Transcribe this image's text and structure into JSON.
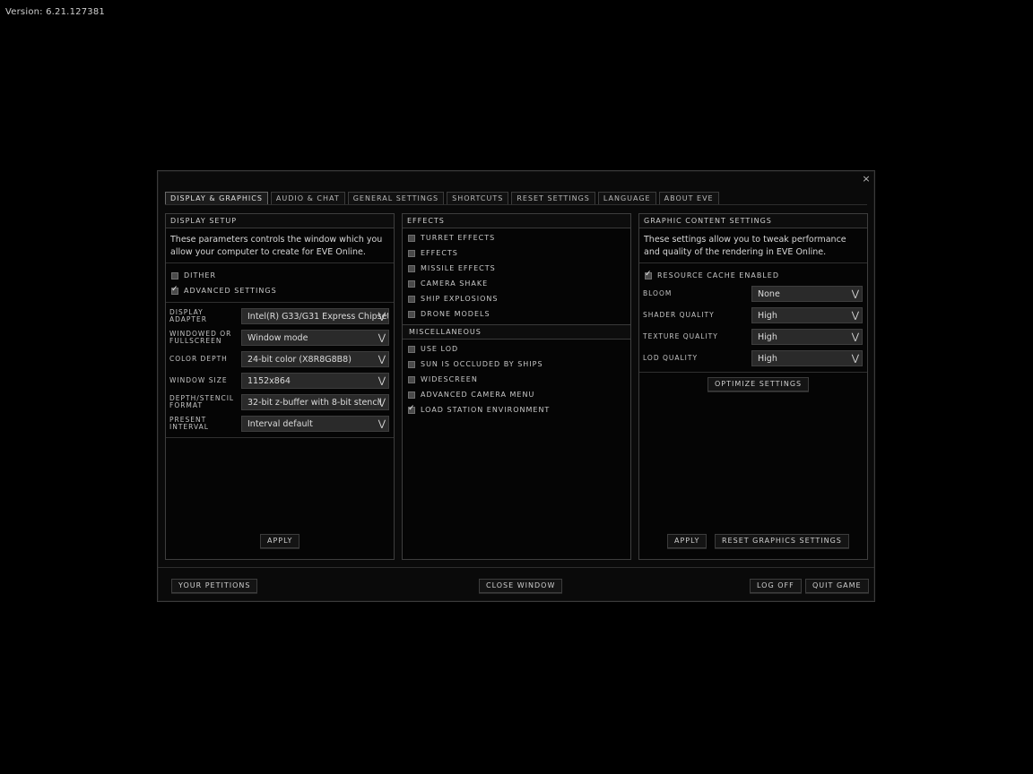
{
  "version_text": "Version: 6.21.127381",
  "window": {
    "close_glyph": "×"
  },
  "tabs": [
    {
      "label": "Display & Graphics",
      "active": true
    },
    {
      "label": "Audio & Chat"
    },
    {
      "label": "General Settings"
    },
    {
      "label": "Shortcuts"
    },
    {
      "label": "Reset Settings"
    },
    {
      "label": "Language"
    },
    {
      "label": "About EVE"
    }
  ],
  "display_setup": {
    "title": "DISPLAY SETUP",
    "description": "These parameters controls the window which you allow your computer to create for EVE Online.",
    "checkboxes": [
      {
        "label": "Dither",
        "checked": false
      },
      {
        "label": "Advanced Settings",
        "checked": true
      }
    ],
    "settings": [
      {
        "label": "Display Adapter",
        "value": "Intel(R) G33/G31 Express Chipset"
      },
      {
        "label": "Windowed or Fullscreen",
        "value": "Window mode"
      },
      {
        "label": "Color Depth",
        "value": "24-bit color (X8R8G8B8)"
      },
      {
        "label": "Window Size",
        "value": "1152x864"
      },
      {
        "label": "Depth/Stencil Format",
        "value": "32-bit z-buffer with 8-bit stencil"
      },
      {
        "label": "Present Interval",
        "value": "Interval default"
      }
    ],
    "apply_label": "Apply"
  },
  "effects": {
    "title": "EFFECTS",
    "checkboxes": [
      {
        "label": "Turret Effects",
        "checked": false
      },
      {
        "label": "Effects",
        "checked": false
      },
      {
        "label": "Missile Effects",
        "checked": false
      },
      {
        "label": "Camera Shake",
        "checked": false
      },
      {
        "label": "Ship Explosions",
        "checked": false
      },
      {
        "label": "Drone Models",
        "checked": false
      }
    ]
  },
  "miscellaneous": {
    "title": "MISCELLANEOUS",
    "checkboxes": [
      {
        "label": "Use LOD",
        "checked": false
      },
      {
        "label": "Sun is occluded by ships",
        "checked": false
      },
      {
        "label": "Widescreen",
        "checked": false
      },
      {
        "label": "Advanced Camera Menu",
        "checked": false
      },
      {
        "label": "Load Station Environment",
        "checked": true
      }
    ]
  },
  "graphic_content": {
    "title": "GRAPHIC CONTENT SETTINGS",
    "description": "These settings allow you to tweak performance and quality of the rendering in EVE Online.",
    "checkbox": {
      "label": "Resource Cache Enabled",
      "checked": true
    },
    "settings": [
      {
        "label": "Bloom",
        "value": "None"
      },
      {
        "label": "Shader Quality",
        "value": "High"
      },
      {
        "label": "Texture Quality",
        "value": "High"
      },
      {
        "label": "LOD Quality",
        "value": "High"
      }
    ],
    "optimize_label": "Optimize Settings",
    "apply_label": "Apply",
    "reset_label": "Reset Graphics Settings"
  },
  "footer": {
    "petitions_label": "Your Petitions",
    "close_label": "Close Window",
    "logoff_label": "Log Off",
    "quit_label": "Quit Game"
  },
  "icons": {
    "chevron": "chevron-down-icon",
    "close": "close-icon",
    "check": "check-icon"
  }
}
